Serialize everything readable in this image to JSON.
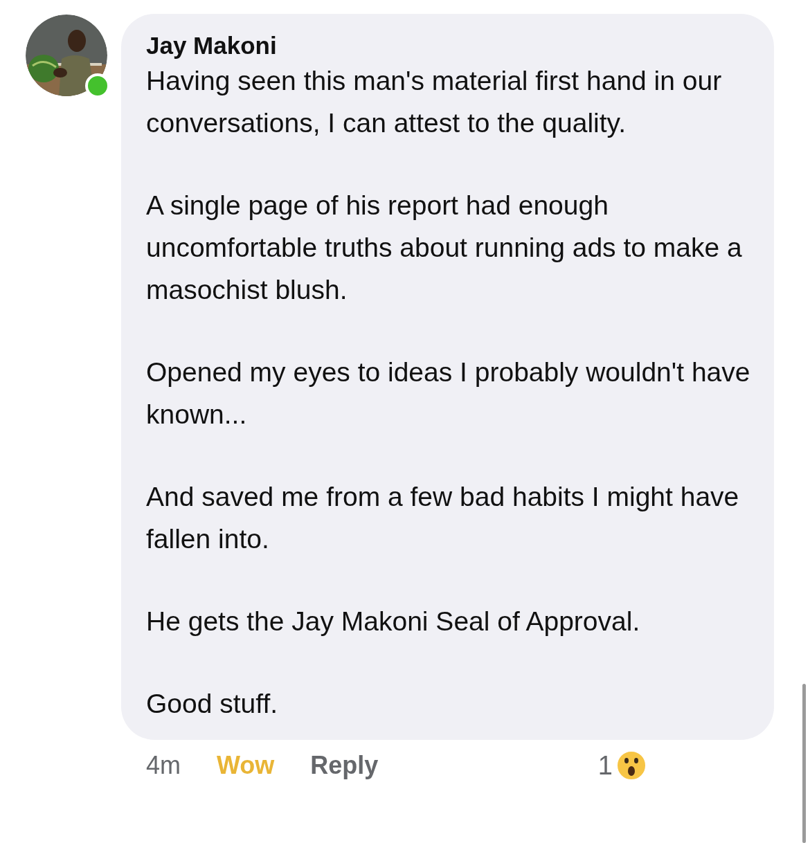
{
  "comment": {
    "author": "Jay Makoni",
    "online": true,
    "paragraphs": [
      "Having seen this man's material first hand in our conversations, I can attest to the quality.",
      "A single page of his report had enough uncomfortable truths about running ads to make a masochist blush.",
      "Opened my eyes to ideas I probably wouldn't have known...",
      "And saved me from a few bad habits I might have fallen into.",
      "He gets the Jay Makoni Seal of Approval.",
      "Good stuff."
    ],
    "time": "4m",
    "reaction_label": "Wow",
    "reacted": true,
    "reply_label": "Reply",
    "reaction_count": "1"
  }
}
